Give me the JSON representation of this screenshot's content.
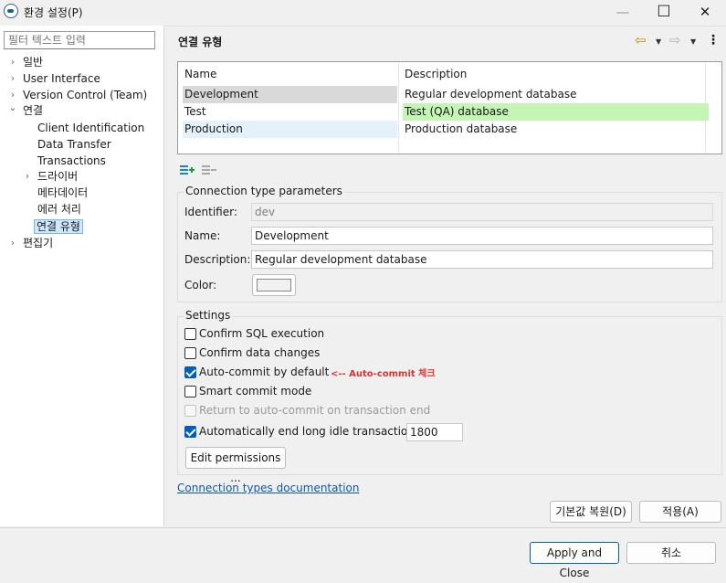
{
  "window": {
    "title": "환경 설정(P)",
    "minimize_glyph": "—",
    "maximize_glyph": "☐",
    "close_glyph": "✕"
  },
  "filter": {
    "placeholder": "필터 텍스트 입력"
  },
  "tree": {
    "collapsed_glyph": "›",
    "expanded_glyph": "⌄",
    "items": [
      {
        "label": "일반",
        "expandable": true,
        "expanded": false
      },
      {
        "label": "User Interface",
        "expandable": true,
        "expanded": false
      },
      {
        "label": "Version Control (Team)",
        "expandable": true,
        "expanded": false
      },
      {
        "label": "연결",
        "expandable": true,
        "expanded": true
      },
      {
        "label": "Client Identification"
      },
      {
        "label": "Data Transfer"
      },
      {
        "label": "Transactions"
      },
      {
        "label": "드라이버",
        "expandable": true,
        "expanded": false
      },
      {
        "label": "메타데이터"
      },
      {
        "label": "에러 처리"
      },
      {
        "label": "연결 유형",
        "selected": true
      },
      {
        "label": "편집기",
        "expandable": true,
        "expanded": false
      }
    ]
  },
  "page": {
    "title": "연결 유형",
    "back_icon": "⇦",
    "forward_icon": "⇨",
    "dropdown_icon": "▼",
    "menu_icon": "⋮"
  },
  "table": {
    "headers": [
      "Name",
      "Description"
    ],
    "rows": [
      {
        "name": "Development",
        "description": "Regular development database",
        "name_bg": "#d9d9d9",
        "desc_bg": "#ffffff"
      },
      {
        "name": "Test",
        "description": "Test (QA) database",
        "name_bg": "#ffffff",
        "desc_bg": "#c4f5b5"
      },
      {
        "name": "Production",
        "description": "Production database",
        "name_bg": "#e3f1fc",
        "desc_bg": "#ffffff"
      }
    ]
  },
  "table_tools": {
    "add_icon": "add-row-icon",
    "remove_icon": "remove-row-icon",
    "add_color": "#1a86c8"
  },
  "params": {
    "group_title": "Connection type parameters",
    "identifier_label": "Identifier:",
    "identifier_value": "dev",
    "name_label": "Name:",
    "name_value": "Development",
    "description_label": "Description:",
    "description_value": "Regular development database",
    "color_label": "Color:",
    "color_value": "#f0f0f0"
  },
  "settings": {
    "group_title": "Settings",
    "options": [
      {
        "label": "Confirm SQL execution",
        "checked": false
      },
      {
        "label": "Confirm data changes",
        "checked": false
      },
      {
        "label": "Auto-commit by default",
        "checked": true
      },
      {
        "label": "Smart commit mode",
        "checked": false
      },
      {
        "label": "Return to auto-commit on transaction end",
        "checked": false,
        "disabled": true
      },
      {
        "label": "Automatically end long idle transactions",
        "checked": true
      }
    ],
    "annotation": "<-- Auto-commit 체크",
    "idle_timeout_value": "1800",
    "edit_permissions_label": "Edit permissions ..."
  },
  "doc_link": "Connection types documentation",
  "buttons": {
    "restore_defaults": "기본값 복원(D)",
    "apply": "적용(A)",
    "apply_and_close": "Apply and Close",
    "cancel": "취소"
  },
  "colors": {
    "accent": "#005fb8",
    "link": "#0b58b4",
    "annotation": "#e03030",
    "nav_arrow": "#c68a00"
  }
}
